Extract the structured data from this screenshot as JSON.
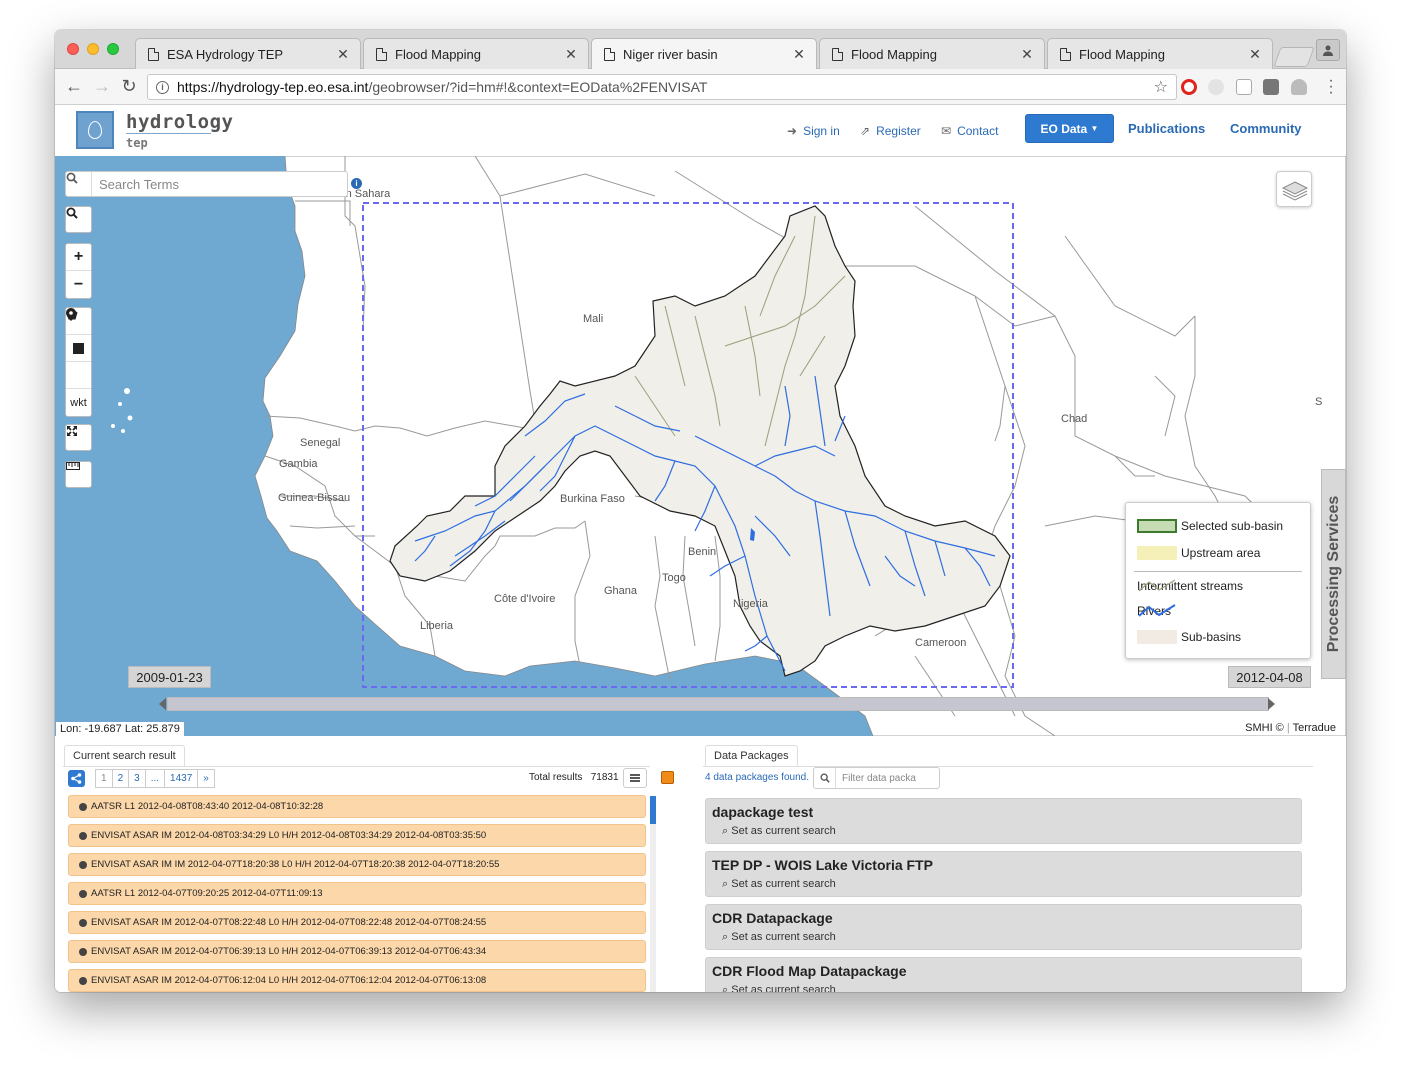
{
  "browser": {
    "tabs": [
      {
        "title": "ESA Hydrology TEP"
      },
      {
        "title": "Flood Mapping"
      },
      {
        "title": "Niger river basin"
      },
      {
        "title": "Flood Mapping"
      },
      {
        "title": "Flood Mapping"
      }
    ],
    "active_tab": 2,
    "url_host": "https://hydrology-tep.eo.esa.int",
    "url_path": "/geobrowser/?id=hm#!&context=EOData%2FENVISAT"
  },
  "site": {
    "logo_main": "hydrology",
    "logo_sub": "tep",
    "sign_in": "Sign in",
    "register": "Register",
    "contact": "Contact",
    "eo_data": "EO Data",
    "publications": "Publications",
    "community": "Community"
  },
  "map": {
    "search_placeholder": "Search Terms",
    "wkt_label": "wkt",
    "processing_services": "Processing Services",
    "labels": {
      "western_sahara": "Western Sahara",
      "mali": "Mali",
      "chad": "Chad",
      "senegal": "Senegal",
      "gambia": "Gambia",
      "guinea_bissau": "Guinea-Bissau",
      "burkina_faso": "Burkina Faso",
      "benin": "Benin",
      "togo": "Togo",
      "ghana": "Ghana",
      "cote_divoire": "Côte d'Ivoire",
      "liberia": "Liberia",
      "nigeria": "Nigeria",
      "cameroon": "Cameroon",
      "edge_s": "S"
    },
    "legend": {
      "selected_sub_basin": "Selected sub-basin",
      "upstream_area": "Upstream area",
      "intermittent_streams": "Intermittent streams",
      "rivers": "Rivers",
      "sub_basins": "Sub-basins"
    },
    "colors": {
      "ocean": "#6fa8d0",
      "basin_fill": "#f1efe9",
      "river": "#2f6ee0",
      "selection_box": "#6a6af0",
      "selected_fill": "#c6dcb4",
      "upstream_fill": "#f5f0b8"
    },
    "time_start": "2009-01-23",
    "time_end": "2012-04-08",
    "coords": "Lon: -19.687 Lat: 25.879",
    "attribution_a": "SMHI ©",
    "attribution_b": "Terradue"
  },
  "results_panel": {
    "tab_label": "Current search result",
    "pages": [
      "1",
      "2",
      "3",
      "...",
      "1437",
      "»"
    ],
    "total_label": "Total results",
    "total_value": "71831",
    "items": [
      "AATSR L1 2012-04-08T08:43:40 2012-04-08T10:32:28",
      "ENVISAT ASAR IM 2012-04-08T03:34:29 L0 H/H 2012-04-08T03:34:29 2012-04-08T03:35:50",
      "ENVISAT ASAR IM IM 2012-04-07T18:20:38 L0 H/H 2012-04-07T18:20:38 2012-04-07T18:20:55",
      "AATSR L1 2012-04-07T09:20:25 2012-04-07T11:09:13",
      "ENVISAT ASAR IM 2012-04-07T08:22:48 L0 H/H 2012-04-07T08:22:48 2012-04-07T08:24:55",
      "ENVISAT ASAR IM 2012-04-07T06:39:13 L0 H/H 2012-04-07T06:39:13 2012-04-07T06:43:34",
      "ENVISAT ASAR IM 2012-04-07T06:12:04 L0 H/H 2012-04-07T06:12:04 2012-04-07T06:13:08"
    ]
  },
  "packages_panel": {
    "tab_label": "Data Packages",
    "found_text": "4 data packages found.",
    "filter_placeholder": "Filter data packa",
    "items": [
      {
        "name": "dapackage test",
        "action": "Set as current search"
      },
      {
        "name": "TEP DP - WOIS Lake Victoria FTP",
        "action": "Set as current search"
      },
      {
        "name": "CDR Datapackage",
        "action": "Set as current search"
      },
      {
        "name": "CDR Flood Map Datapackage",
        "action": "Set as current search"
      }
    ]
  }
}
